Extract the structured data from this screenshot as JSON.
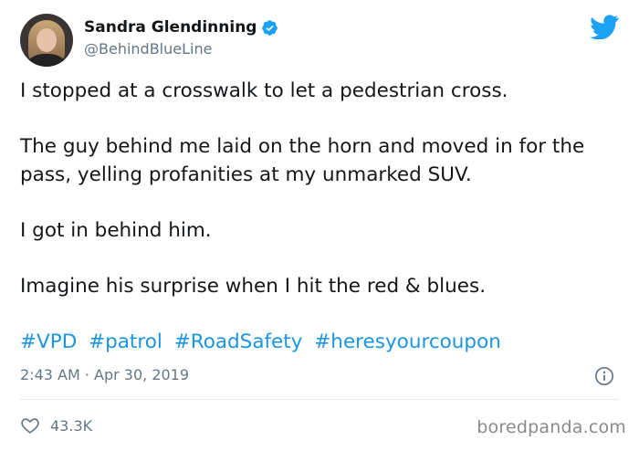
{
  "user": {
    "display_name": "Sandra Glendinning",
    "handle": "@BehindBlueLine",
    "verified": true
  },
  "tweet": {
    "paragraphs": [
      "I stopped at a crosswalk to let a pedestrian cross.",
      "The guy behind me laid on the horn and moved in for the pass, yelling profanities at my unmarked SUV.",
      "I got in behind him.",
      "Imagine his surprise when I hit the red & blues."
    ],
    "hashtags": [
      "#VPD",
      "#patrol",
      "#RoadSafety",
      "#heresyourcoupon"
    ],
    "timestamp": "2:43 AM · Apr 30, 2019",
    "likes": "43.3K"
  },
  "watermark": "boredpanda.com",
  "colors": {
    "link": "#1b95e0",
    "twitter_blue": "#1da1f2",
    "muted": "#657786",
    "text": "#14171a"
  },
  "icons": [
    "verified-badge-icon",
    "twitter-bird-icon",
    "info-icon",
    "heart-icon"
  ]
}
